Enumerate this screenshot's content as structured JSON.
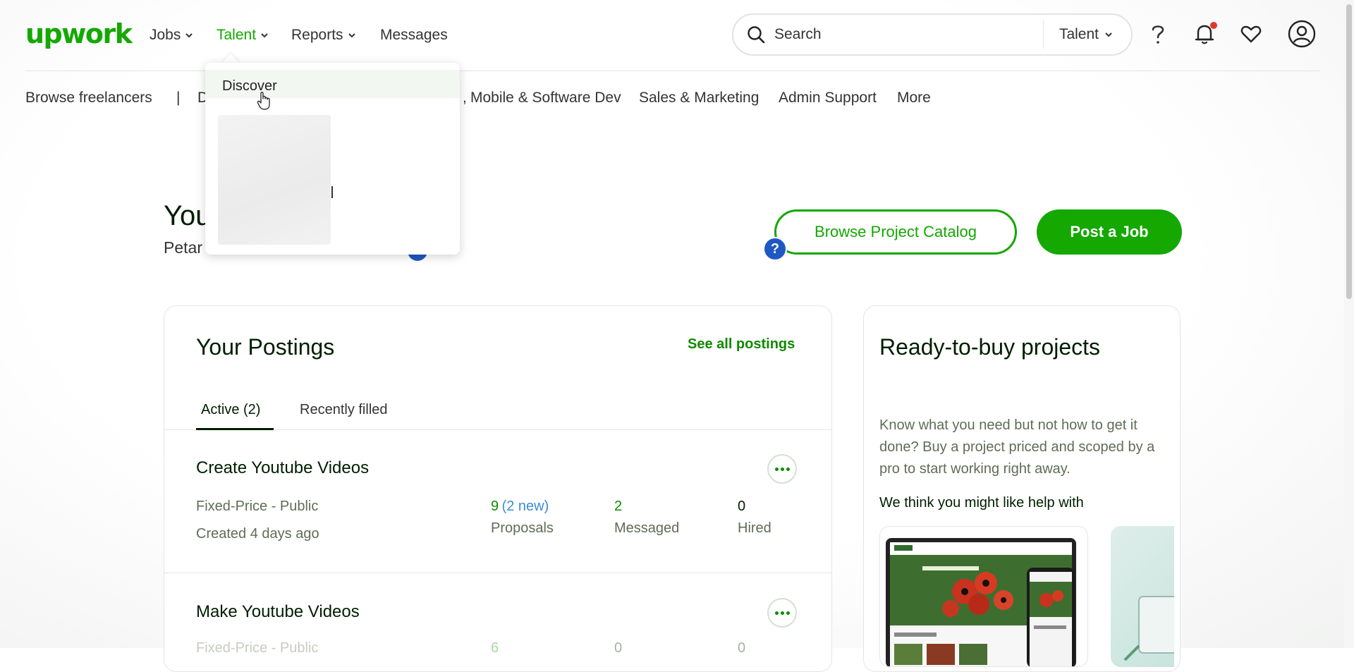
{
  "header": {
    "logo": "upwork",
    "nav": [
      {
        "label": "Jobs"
      },
      {
        "label": "Talent"
      },
      {
        "label": "Reports"
      },
      {
        "label": "Messages"
      }
    ],
    "search": {
      "placeholder": "Search",
      "scope": "Talent"
    }
  },
  "subnav": {
    "browse": "Browse freelancers",
    "separator": "|",
    "partial": "D",
    "categories": [
      "Mobile & Software Dev",
      "Sales & Marketing",
      "Admin Support",
      "More"
    ],
    "partial_prefix": ","
  },
  "dropdown": {
    "items": [
      {
        "label": "Discover"
      }
    ]
  },
  "greeting": {
    "title": "You",
    "subtitle": "Petar"
  },
  "actions": {
    "browse_catalog": "Browse Project Catalog",
    "post_job": "Post a Job",
    "help": "?"
  },
  "postings": {
    "title": "Your Postings",
    "see_all": "See all postings",
    "tabs": [
      {
        "label": "Active (2)"
      },
      {
        "label": "Recently filled"
      }
    ],
    "jobs": [
      {
        "title": "Create Youtube Videos",
        "type": "Fixed-Price - Public",
        "created": "Created 4 days ago",
        "proposals": "9",
        "proposals_new": "(2 new)",
        "proposals_label": "Proposals",
        "messaged": "2",
        "messaged_label": "Messaged",
        "hired": "0",
        "hired_label": "Hired"
      },
      {
        "title": "Make Youtube Videos",
        "type": "Fixed-Price - Public",
        "proposals": "6",
        "messaged": "0",
        "hired": "0"
      }
    ]
  },
  "ready_to_buy": {
    "title": "Ready-to-buy projects",
    "description": "Know what you need but not how to get it done? Buy a project priced and scoped by a pro to start working right away.",
    "subtitle": "We think you might like help with"
  },
  "colors": {
    "brand": "#14a800",
    "link": "#108a00",
    "info": "#3c8dd6",
    "badge": "#1f57c3"
  }
}
